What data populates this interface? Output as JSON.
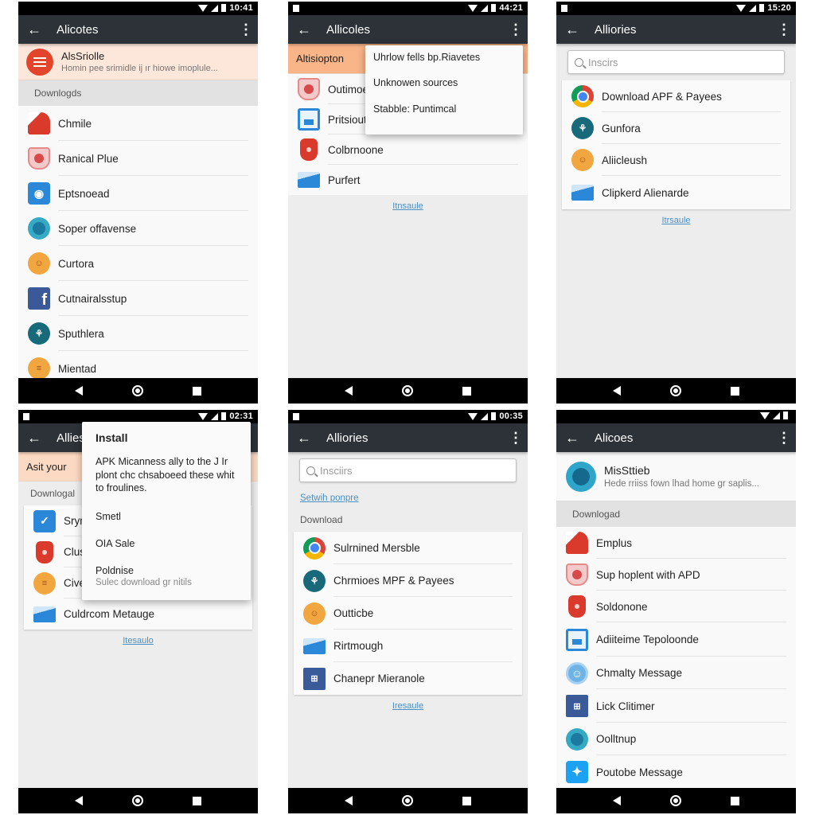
{
  "screens": [
    {
      "status_time": "10:41",
      "title": "Alicotes",
      "banner": {
        "title": "AlsSriolle",
        "subtitle": "Homin pee srimidle ij ır hiowe imoplule...",
        "icon": "list-icon"
      },
      "section_label": "Downlogds",
      "items": [
        {
          "label": "Chmile",
          "icon": "red-app-icon"
        },
        {
          "label": "Ranical Plue",
          "icon": "shield-app-icon"
        },
        {
          "label": "Eptsnoead",
          "icon": "blue-app-icon"
        },
        {
          "label": "Soper offavense",
          "icon": "teal-circle-icon"
        },
        {
          "label": "Curtora",
          "icon": "orange-circle-icon"
        },
        {
          "label": "Cutnairalsstup",
          "icon": "facebook-icon"
        },
        {
          "label": "Sputhlera",
          "icon": "dark-teal-circle-icon"
        },
        {
          "label": "Mientad",
          "icon": "orange-menu-icon"
        }
      ]
    },
    {
      "status_time": "44:21",
      "title": "Allicoles",
      "banner": {
        "title": "Altisiopton"
      },
      "items": [
        {
          "label": "Outimoe",
          "icon": "shield-app-icon"
        },
        {
          "label": "Pritsiout",
          "icon": "window-app-icon"
        },
        {
          "label": "Colbrnoone",
          "icon": "red-hat-icon"
        },
        {
          "label": "Purfert",
          "icon": "mail-icon"
        }
      ],
      "footer_link": "Itnsaule",
      "menu": [
        "Uhrlow fells bp.Riavetes",
        "Unknowen sources",
        "Stabble: Puntimcal"
      ]
    },
    {
      "status_time": "15:20",
      "title": "Alliories",
      "search_placeholder": "Inscirs",
      "items": [
        {
          "label": "Download APF & Payees",
          "icon": "chrome-icon"
        },
        {
          "label": "Gunfora",
          "icon": "dark-teal-circle-icon"
        },
        {
          "label": "Aliicleush",
          "icon": "orange-circle-icon"
        },
        {
          "label": "Clipkerd Alienarde",
          "icon": "mail-icon"
        }
      ],
      "footer_link": "Itrsaule"
    },
    {
      "status_time": "02:31",
      "title": "Allies",
      "banner": {
        "title": "Asit your"
      },
      "section_label": "Downlogal",
      "items": [
        {
          "label": "Srym",
          "icon": "blue-app-icon"
        },
        {
          "label": "Clus",
          "icon": "red-hat-icon"
        },
        {
          "label": "Civer",
          "icon": "orange-circle-icon"
        },
        {
          "label": "Culdrcom Metauge",
          "icon": "mail-icon"
        }
      ],
      "footer_link": "Itesaulo",
      "dialog": {
        "title": "Install",
        "body": "APK Micanness ally to the J Ir plont chc chsaboeed these whit to froulines.",
        "options": [
          {
            "label": "Smetl"
          },
          {
            "label": "OIA Sale"
          },
          {
            "label": "Poldnise",
            "sublabel": "Sulec download gr nitils"
          }
        ]
      }
    },
    {
      "status_time": "00:35",
      "title": "Alliories",
      "search_placeholder": "Insciirs",
      "sub_link": "Setwih ponpre",
      "section_label": "Download",
      "items": [
        {
          "label": "Sulrnined Mersble",
          "icon": "chrome-icon"
        },
        {
          "label": "Chrmioes MPF & Payees",
          "icon": "dark-teal-circle-icon"
        },
        {
          "label": "Outticbe",
          "icon": "orange-circle-icon"
        },
        {
          "label": "Rirtmough",
          "icon": "mail-icon"
        },
        {
          "label": "Chanepr Mieranole",
          "icon": "navy-app-icon"
        }
      ],
      "footer_link": "Iresaule"
    },
    {
      "status_time": "",
      "title": "Alicoes",
      "header": {
        "title": "MisSttieb",
        "subtitle": "Hede rriiss fown lhad home gr saplis..."
      },
      "section_label": "Downlogad",
      "items": [
        {
          "label": "Emplus",
          "icon": "red-app-icon"
        },
        {
          "label": "Sup hoplent with APD",
          "icon": "shield-app-icon"
        },
        {
          "label": "Soldonone",
          "icon": "red-hat-icon"
        },
        {
          "label": "Adiiteime Tepoloonde",
          "icon": "window-app-icon"
        },
        {
          "label": "Chmalty Message",
          "icon": "light-blue-circle-icon"
        },
        {
          "label": "Lick Clitimer",
          "icon": "navy-app-icon"
        },
        {
          "label": "Oolltnup",
          "icon": "teal-circle-icon"
        },
        {
          "label": "Poutobe Message",
          "icon": "twitter-icon"
        }
      ]
    }
  ],
  "glyphs": {
    "back": "←",
    "more": "⋮",
    "facebook": "f",
    "twitter": "🐦",
    "teal": "⚘",
    "orange": "☺",
    "navy": "⊞",
    "smile": "☺"
  },
  "colors": {
    "appbar": "#2c3237",
    "banner_light": "#fde7da",
    "banner_strong": "#f9b488",
    "accent_red": "#e2452c",
    "link": "#4a90c2"
  }
}
